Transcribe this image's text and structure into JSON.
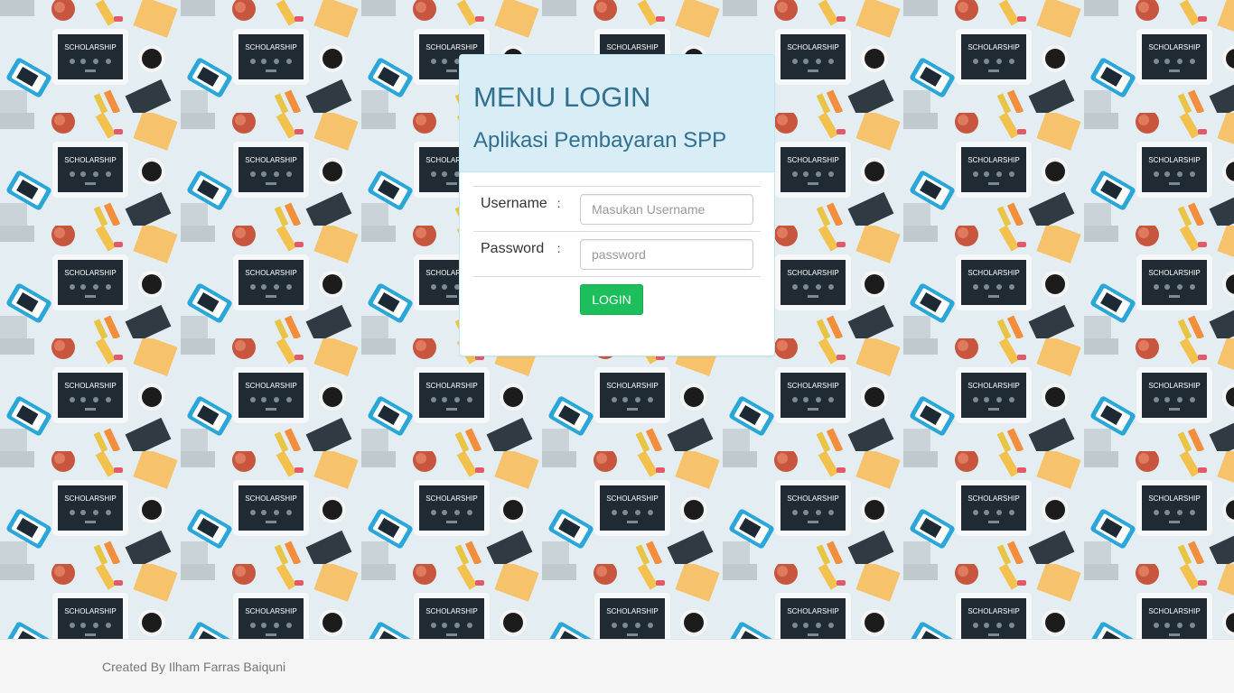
{
  "background": {
    "tile_text": "SCHOLARSHIP"
  },
  "panel": {
    "title": "MENU LOGIN",
    "subtitle": "Aplikasi Pembayaran SPP"
  },
  "form": {
    "username_label": "Username",
    "username_colon": ":",
    "username_placeholder": "Masukan Username",
    "username_value": "",
    "password_label": "Password",
    "password_colon": ":",
    "password_placeholder": "password",
    "password_value": "",
    "login_label": "LOGIN"
  },
  "footer": {
    "text": "Created By Ilham Farras Baiquni"
  },
  "colors": {
    "panel_heading_bg": "#d9edf7",
    "panel_heading_text": "#31708f",
    "login_button": "#1dbf5c",
    "footer_bg": "#f5f5f5"
  }
}
